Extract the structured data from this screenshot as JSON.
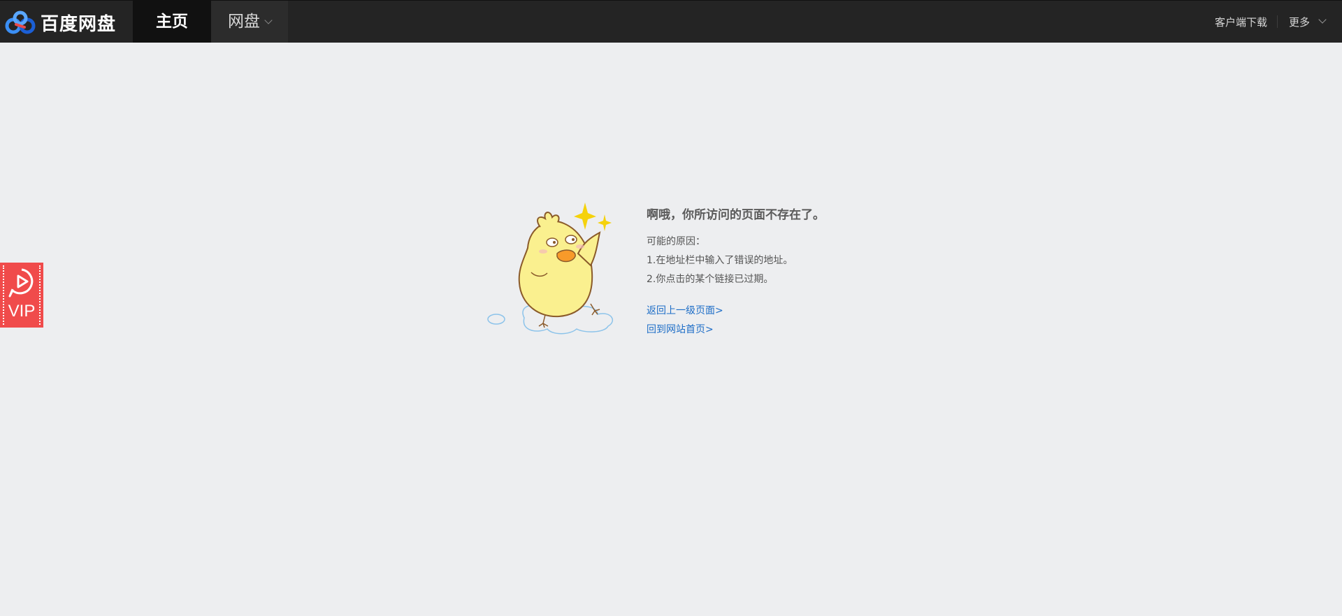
{
  "header": {
    "logo_text": "百度网盘",
    "nav_home": "主页",
    "nav_disk": "网盘",
    "client_download": "客户端下载",
    "more": "更多"
  },
  "vip_badge": {
    "label": "VIP",
    "icon": "play-circle-icon"
  },
  "error": {
    "title": "啊哦，你所访问的页面不存在了。",
    "reasons_heading": "可能的原因：",
    "reasons": [
      "1.在地址栏中输入了错误的地址。",
      "2.你点击的某个链接已过期。"
    ],
    "links": [
      "返回上一级页面>",
      "回到网站首页>"
    ],
    "illustration": "chick-icon"
  },
  "colors": {
    "topbar": "#242424",
    "nav_active": "#111111",
    "background": "#edeef0",
    "link": "#1d6dc7",
    "vip_badge": "#f04b4b",
    "logo_blue": "#3b8ff5"
  }
}
